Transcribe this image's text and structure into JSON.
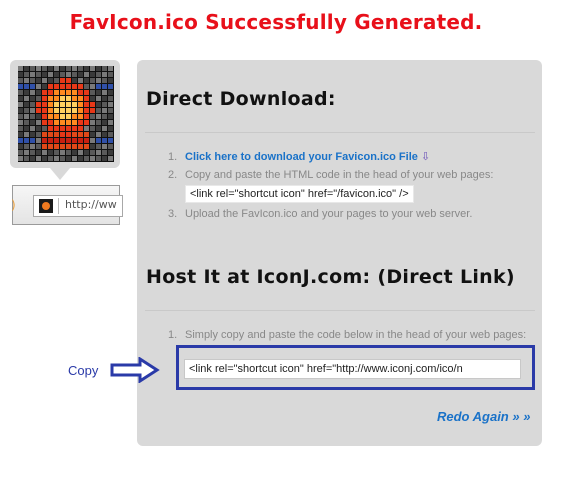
{
  "title": "FavIcon.ico Successfully Generated.",
  "preview": {
    "url_text": "http://ww"
  },
  "direct_download": {
    "heading": "Direct Download:",
    "steps": [
      {
        "num": "1.",
        "link_text": "Click here to download your Favicon.ico File"
      },
      {
        "num": "2.",
        "text": "Copy and paste the HTML code in the head of your web pages:",
        "code": "<link rel=\"shortcut icon\" href=\"/favicon.ico\" />"
      },
      {
        "num": "3.",
        "text": "Upload the FavIcon.ico and your pages to your web server."
      }
    ]
  },
  "host": {
    "heading": "Host It at IconJ.com: (Direct Link)",
    "steps": [
      {
        "num": "1.",
        "text": "Simply copy and paste the code below in the head of your web pages:"
      }
    ],
    "code": "<link rel=\"shortcut icon\" href=\"http://www.iconj.com/ico/n"
  },
  "copy_label": "Copy",
  "redo_label": "Redo Again » »",
  "colors": {
    "title": "#e8101a",
    "link": "#1a72c8",
    "highlight": "#2a3aa8",
    "panel": "#d9d9d9"
  },
  "icons": [
    "download-arrow-icon",
    "right-arrow-icon",
    "favicon-preview-icon"
  ]
}
